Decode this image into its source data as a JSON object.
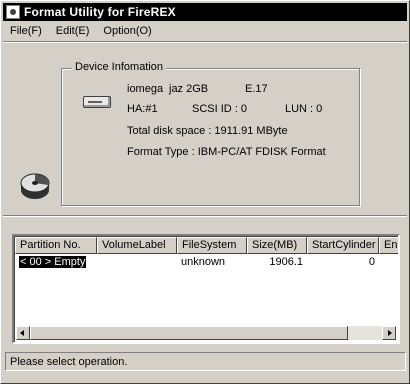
{
  "window": {
    "title": "Format Utility for FireREX"
  },
  "menu": [
    "File(F)",
    "Edit(E)",
    "Option(O)"
  ],
  "device_info": {
    "legend": "Device Infomation",
    "vendor": "iomega",
    "model": "jaz 2GB",
    "revision": "E.17",
    "ha": "HA:#1",
    "scsi_id": "SCSI ID : 0",
    "lun": "LUN : 0",
    "total_space": "Total disk space : 1911.91 MByte",
    "format_type": "Format Type : IBM-PC/AT FDISK Format"
  },
  "partition_table": {
    "columns": [
      "Partition No.",
      "VolumeLabel",
      "FileSystem",
      "Size(MB)",
      "StartCylinder",
      "End"
    ],
    "rows": [
      {
        "partition": "< 00 > Empty",
        "volume_label": "",
        "file_system": "unknown",
        "size_mb": "1906.1",
        "start_cylinder": "0",
        "end": ""
      }
    ]
  },
  "status": {
    "text": "Please select operation."
  }
}
